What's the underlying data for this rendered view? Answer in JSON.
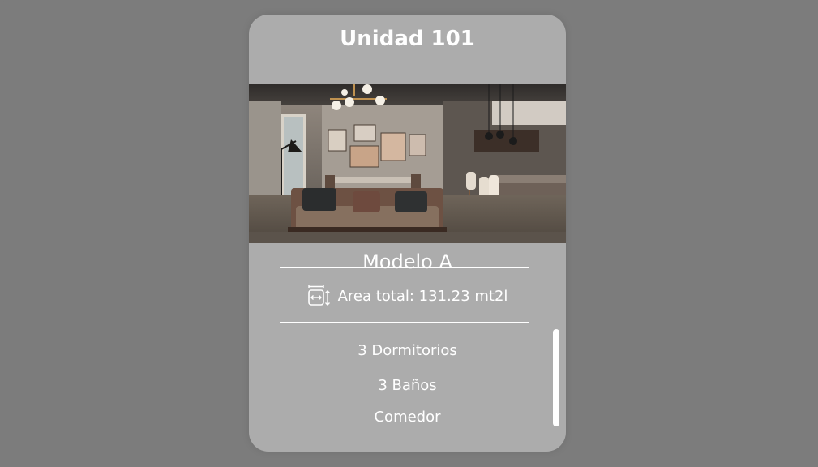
{
  "card": {
    "title": "Unidad 101",
    "model": "Modelo A",
    "area_label": "Area total: 131.23 mt2l",
    "area_icon": "area-dimensions-icon",
    "features": [
      "3 Dormitorios",
      "3 Baños",
      "Comedor"
    ]
  },
  "colors": {
    "background": "#7c7c7c",
    "card": "#acacac",
    "text": "#ffffff"
  }
}
